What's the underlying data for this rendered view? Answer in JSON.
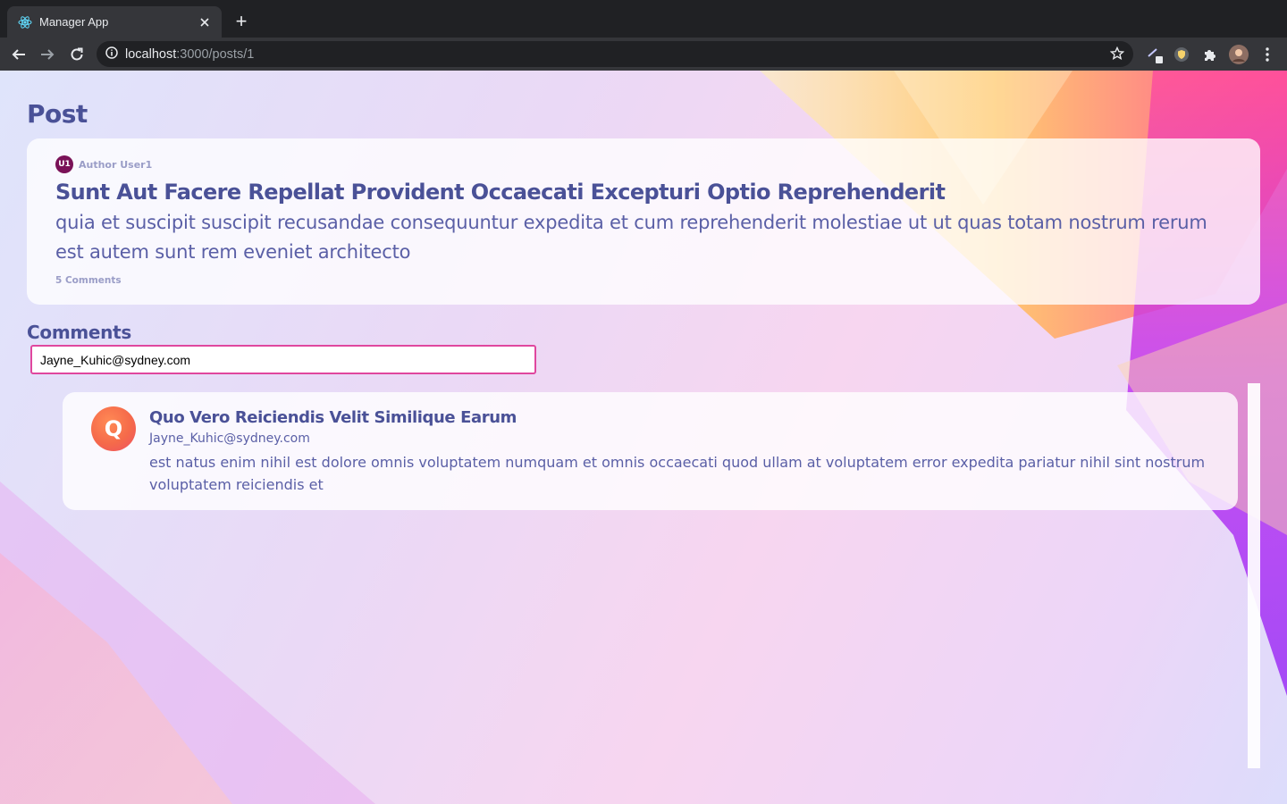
{
  "browser": {
    "tab": {
      "title": "Manager App",
      "favicon": "react-icon"
    },
    "url": {
      "host": "localhost",
      "path": ":3000/posts/1"
    }
  },
  "page": {
    "title": "Post",
    "post": {
      "author_initials": "U1",
      "author": "Author User1",
      "title": "Sunt Aut Facere Repellat Provident Occaecati Excepturi Optio Reprehenderit",
      "body": "quia et suscipit suscipit recusandae consequuntur expedita et cum reprehenderit molestiae ut ut quas totam nostrum rerum est autem sunt rem eveniet architecto",
      "comments_count": "5 Comments"
    },
    "comments_heading": "Comments",
    "filter": {
      "value": "Jayne_Kuhic@sydney.com"
    },
    "comments": [
      {
        "avatar_letter": "Q",
        "title": "Quo Vero Reiciendis Velit Similique Earum",
        "email": "Jayne_Kuhic@sydney.com",
        "body": "est natus enim nihil est dolore omnis voluptatem numquam et omnis occaecati quod ullam at voluptatem error expedita pariatur nihil sint nostrum voluptatem reiciendis et"
      }
    ]
  },
  "colors": {
    "heading": "#4a5197",
    "text": "#5a5fa6",
    "muted": "#9a9dc7",
    "input_border": "#e0479e",
    "author_avatar": "#7a1257"
  }
}
